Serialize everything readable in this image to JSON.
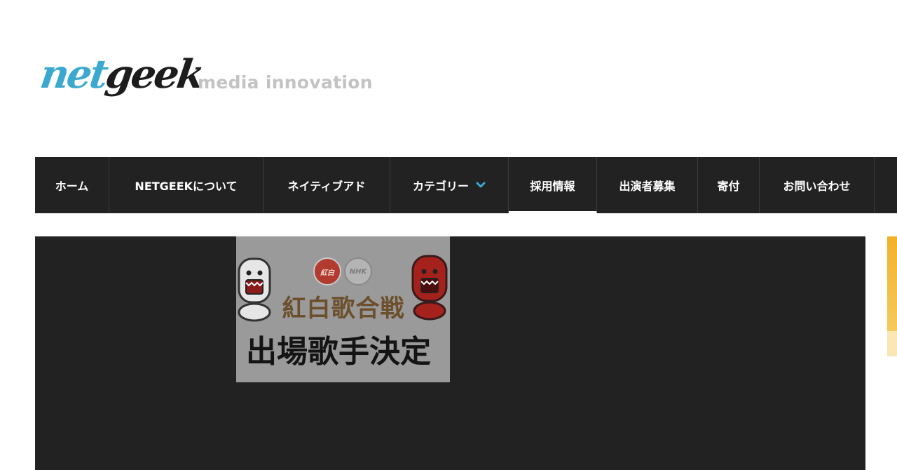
{
  "logo": {
    "word_part1": "net",
    "word_part2": "geek",
    "tagline": "media innovation",
    "colors": {
      "net": "#3ba9cf",
      "geek": "#1d1d1d",
      "tagline": "#c3c3c3"
    }
  },
  "nav": {
    "background": "#222222",
    "items": [
      {
        "label": "ホーム"
      },
      {
        "label": "NETGEEKについて"
      },
      {
        "label": "ネイティブアド"
      },
      {
        "label": "カテゴリー",
        "has_dropdown": true,
        "icon": "chevron-down-icon",
        "icon_color": "#3ba9cf"
      },
      {
        "label": "採用情報",
        "active": true
      },
      {
        "label": "出演者募集"
      },
      {
        "label": "寄付"
      },
      {
        "label": "お問い合わせ"
      }
    ]
  },
  "hero": {
    "background": "#222222",
    "thumbnail": {
      "badge_left": "紅白",
      "badge_right": "NHK",
      "title_line1": "紅白歌合戦",
      "title_line2": "出場歌手決定"
    }
  },
  "side_ad": {
    "color": "#f1b22a"
  }
}
